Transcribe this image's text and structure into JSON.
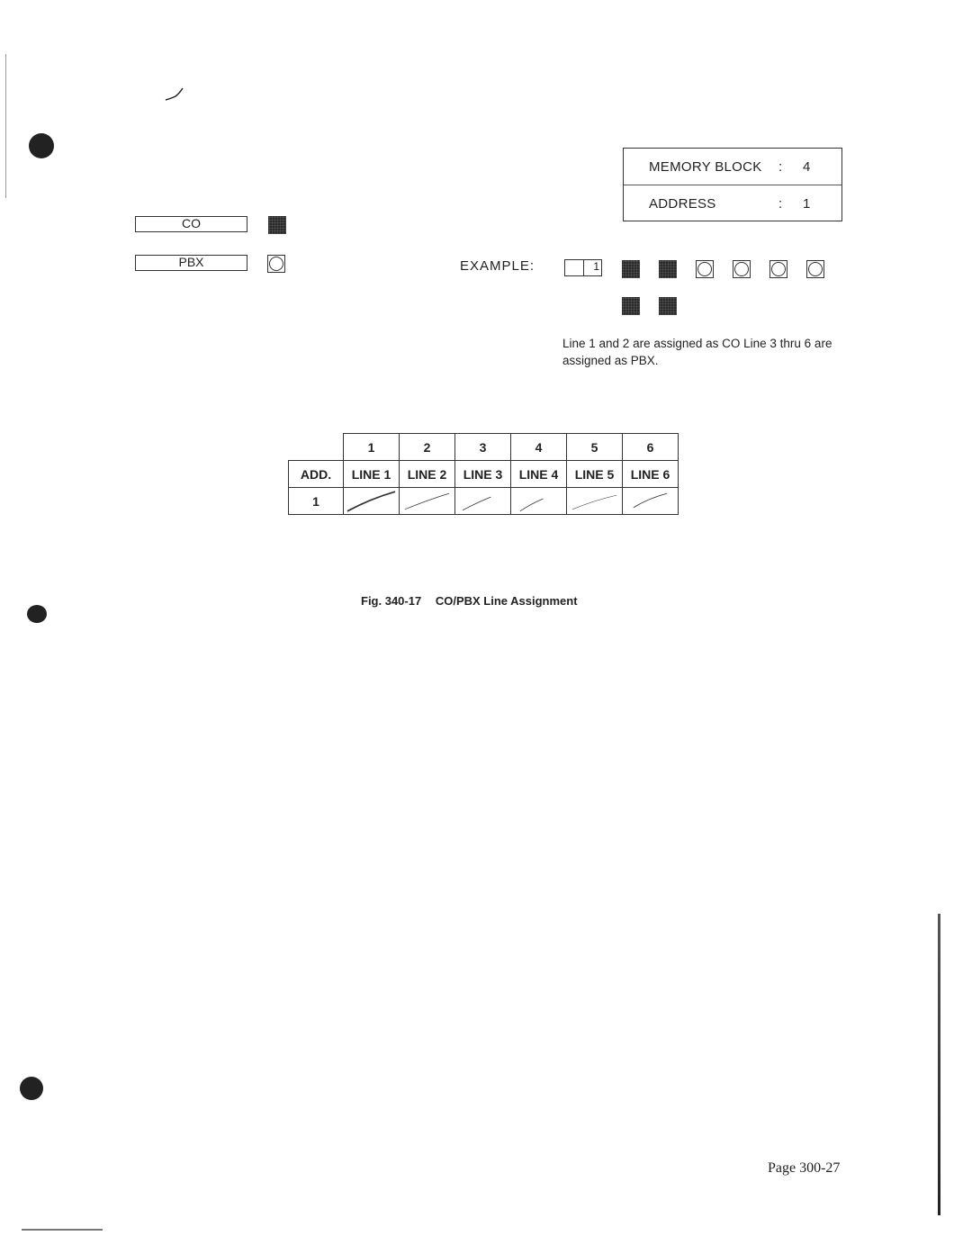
{
  "memory_info": {
    "rows": [
      {
        "label": "MEMORY BLOCK",
        "separator": ":",
        "value": "4"
      },
      {
        "label": "ADDRESS",
        "separator": ":",
        "value": "1"
      }
    ]
  },
  "legend": {
    "items": [
      {
        "label": "CO",
        "lamp": "on",
        "icon": "lamp-lit-icon"
      },
      {
        "label": "PBX",
        "lamp": "off",
        "icon": "lamp-unlit-icon"
      }
    ]
  },
  "example": {
    "label": "EXAMPLE:",
    "address_digits": [
      "",
      "1"
    ],
    "lamps_row1": [
      "on",
      "on",
      "off",
      "off",
      "off",
      "off"
    ],
    "lamps_row2": [
      "on",
      "on"
    ],
    "note": "Line 1 and 2 are assigned as CO Line 3 thru 6 are assigned as PBX."
  },
  "table": {
    "column_numbers": [
      "1",
      "2",
      "3",
      "4",
      "5",
      "6"
    ],
    "header_label": "ADD.",
    "line_headers": [
      "LINE 1",
      "LINE 2",
      "LINE 3",
      "LINE 4",
      "LINE 5",
      "LINE 6"
    ],
    "rows": [
      {
        "address": "1",
        "cells": [
          "",
          "",
          "",
          "",
          "",
          ""
        ]
      }
    ]
  },
  "caption": {
    "number": "Fig. 340-17",
    "title": "CO/PBX Line Assignment"
  },
  "footer": {
    "page_number": "Page 300-27"
  }
}
